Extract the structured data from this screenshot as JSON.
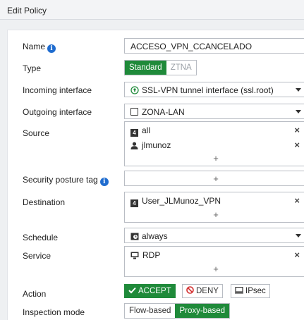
{
  "header": {
    "title": "Edit Policy"
  },
  "form": {
    "name": {
      "label": "Name",
      "value": "ACCESO_VPN_CCANCELADO"
    },
    "type": {
      "label": "Type",
      "options": [
        "Standard",
        "ZTNA"
      ],
      "selected": "Standard"
    },
    "incoming": {
      "label": "Incoming interface",
      "value": "SSL-VPN tunnel interface (ssl.root)"
    },
    "outgoing": {
      "label": "Outgoing interface",
      "value": "ZONA-LAN"
    },
    "source": {
      "label": "Source",
      "items": [
        "all",
        "jlmunoz"
      ],
      "add": "+"
    },
    "posture": {
      "label": "Security posture tag",
      "add": "+"
    },
    "destination": {
      "label": "Destination",
      "items": [
        "User_JLMunoz_VPN"
      ],
      "add": "+"
    },
    "schedule": {
      "label": "Schedule",
      "value": "always"
    },
    "service": {
      "label": "Service",
      "items": [
        "RDP"
      ],
      "add": "+"
    },
    "action": {
      "label": "Action",
      "options": [
        "ACCEPT",
        "DENY",
        "IPsec"
      ],
      "selected": "ACCEPT"
    },
    "inspection": {
      "label": "Inspection mode",
      "options": [
        "Flow-based",
        "Proxy-based"
      ],
      "selected": "Proxy-based"
    }
  },
  "icons": {
    "remove": "×"
  },
  "colors": {
    "accent": "#1f8a3a",
    "info": "#1f6ccf",
    "deny": "#d32f2f"
  }
}
